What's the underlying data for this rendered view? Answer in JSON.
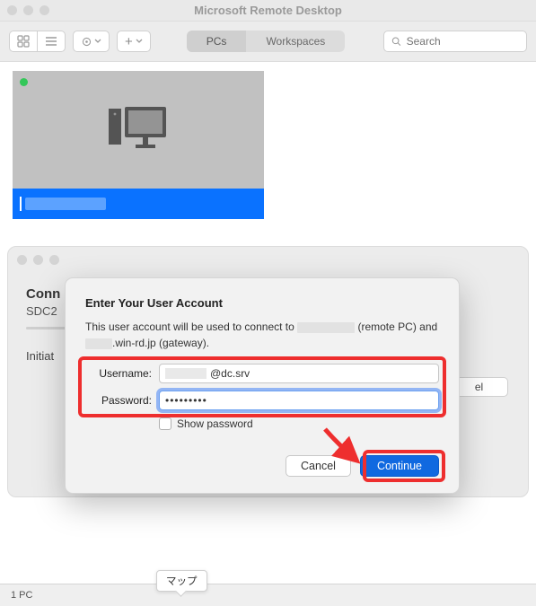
{
  "window": {
    "title": "Microsoft Remote Desktop"
  },
  "toolbar": {
    "segments": {
      "pcs": "PCs",
      "workspaces": "Workspaces"
    },
    "search_placeholder": "Search"
  },
  "card": {
    "connected": true
  },
  "connect_panel": {
    "title_prefix": "Conn",
    "subtitle_prefix": "SDC2",
    "status_prefix": "Initiat",
    "cancel_fragment": "el"
  },
  "dialog": {
    "title": "Enter Your User Account",
    "desc1": "This user account will be used to connect to ",
    "desc2": " (remote PC) and ",
    "desc3": ".win-rd.jp (gateway).",
    "username_label": "Username:",
    "username_suffix": "@dc.srv",
    "password_label": "Password:",
    "password_value": "•••••••••",
    "show_password": "Show password",
    "cancel": "Cancel",
    "continue": "Continue"
  },
  "statusbar": {
    "count": "1 PC"
  },
  "tooltip": {
    "text": "マップ"
  }
}
